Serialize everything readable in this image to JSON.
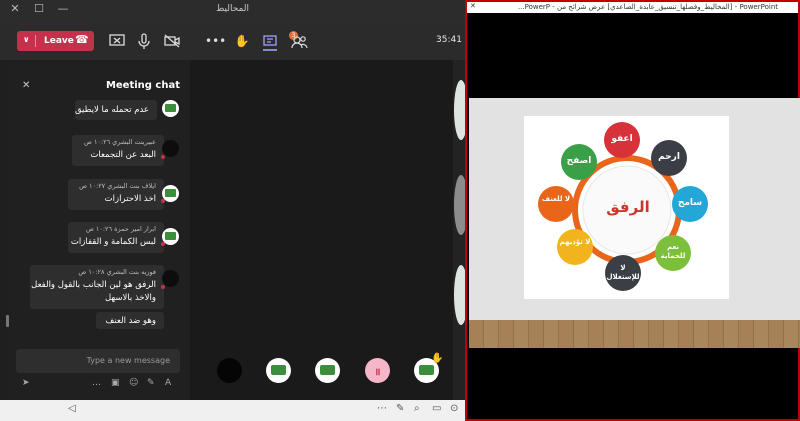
{
  "teams": {
    "window_title": "المحاليط",
    "toolbar": {
      "leave_label": "Leave",
      "timer": "35:41",
      "chat_badge": "3"
    },
    "chat": {
      "title": "Meeting chat",
      "messages": [
        {
          "sender": "",
          "time": "",
          "text": "عدم تحمله ما لايطيق",
          "avatar": "logo"
        },
        {
          "sender": "عبيرينت البشري",
          "time": "١٠:٢٦ ص",
          "text": "البعد عن التجمعات",
          "avatar": "dark"
        },
        {
          "sender": "ايلاف بنت البشري",
          "time": "١٠:٢٧ ص",
          "text": "اخذ الاحترازات",
          "avatar": "logo"
        },
        {
          "sender": "ابرار امير حمزة",
          "time": "١٠:٢٦ ص",
          "text": "لبس الكمامة و القفازات",
          "avatar": "logo"
        },
        {
          "sender": "فوزيه بنت البشري",
          "time": "١٠:٢٨ ص",
          "text": "الرفق هو لين الجانب بالقول والفعل",
          "text2": "والاخذ بالاسهل",
          "avatar": "dark"
        },
        {
          "sender": "",
          "time": "",
          "text": "وهو ضد العنف",
          "avatar": ""
        }
      ],
      "input_placeholder": "Type a new message"
    }
  },
  "powerpoint": {
    "window_title": "PowerPoint - [المخاليط_وفصلها_تنسيق_عابدة_الصاعدي] عرض شرائح من - PowerP...",
    "slide": {
      "center_label": "الرفق",
      "petals": [
        {
          "label": "اعفو",
          "color": "#d7323a"
        },
        {
          "label": "ارحم",
          "color": "#3b3f45"
        },
        {
          "label": "سامح",
          "color": "#22a7d6"
        },
        {
          "label": "نعم للحماية",
          "color": "#7bbf3a"
        },
        {
          "label": "لا للإستغلال",
          "color": "#3b3f45"
        },
        {
          "label": "لا تؤذيهم",
          "color": "#f2b41c"
        },
        {
          "label": "لا للعنف",
          "color": "#e8651a"
        },
        {
          "label": "اصفح",
          "color": "#3aa048"
        }
      ],
      "ring_color": "#e8651a"
    }
  }
}
